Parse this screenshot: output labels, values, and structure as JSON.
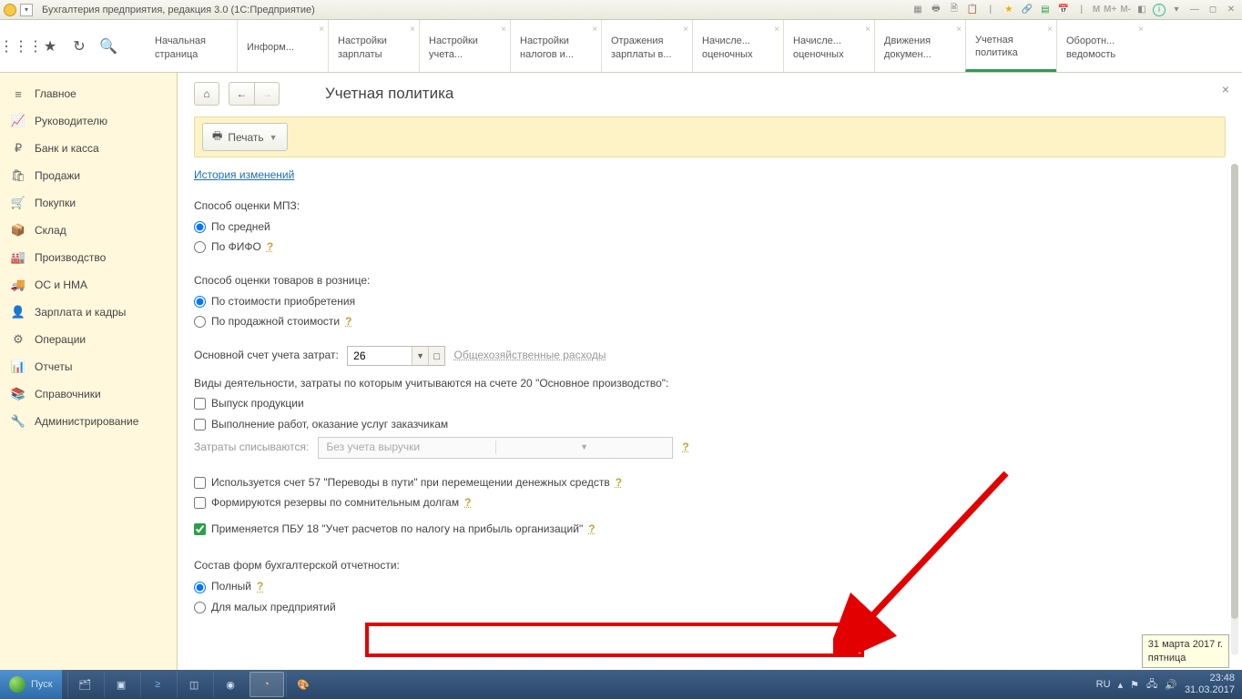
{
  "titlebar": {
    "app_title": "Бухгалтерия предприятия, редакция 3.0  (1С:Предприятие)",
    "m1": "М",
    "m2": "М+",
    "m3": "М-"
  },
  "tabs": [
    {
      "l1": "Начальная",
      "l2": "страница"
    },
    {
      "l1": "Информ...",
      "l2": ""
    },
    {
      "l1": "Настройки",
      "l2": "зарплаты"
    },
    {
      "l1": "Настройки",
      "l2": "учета..."
    },
    {
      "l1": "Настройки",
      "l2": "налогов и..."
    },
    {
      "l1": "Отражения",
      "l2": "зарплаты в..."
    },
    {
      "l1": "Начисле...",
      "l2": "оценочных"
    },
    {
      "l1": "Начисле...",
      "l2": "оценочных"
    },
    {
      "l1": "Движения",
      "l2": "докумен..."
    },
    {
      "l1": "Учетная",
      "l2": "политика"
    },
    {
      "l1": "Оборотн...",
      "l2": "ведомость"
    }
  ],
  "sidebar": [
    {
      "icon": "≡",
      "label": "Главное"
    },
    {
      "icon": "📈",
      "label": "Руководителю"
    },
    {
      "icon": "₽",
      "label": "Банк и касса"
    },
    {
      "icon": "🛍",
      "label": "Продажи"
    },
    {
      "icon": "🛒",
      "label": "Покупки"
    },
    {
      "icon": "📦",
      "label": "Склад"
    },
    {
      "icon": "🏭",
      "label": "Производство"
    },
    {
      "icon": "🚚",
      "label": "ОС и НМА"
    },
    {
      "icon": "👤",
      "label": "Зарплата и кадры"
    },
    {
      "icon": "⚙",
      "label": "Операции"
    },
    {
      "icon": "📊",
      "label": "Отчеты"
    },
    {
      "icon": "📚",
      "label": "Справочники"
    },
    {
      "icon": "🔧",
      "label": "Администрирование"
    }
  ],
  "page": {
    "title": "Учетная политика",
    "print": "Печать",
    "history_link": "История изменений",
    "mpz_label": "Способ оценки МПЗ:",
    "mpz_opt1": "По средней",
    "mpz_opt2": "По ФИФО",
    "retail_label": "Способ оценки товаров в рознице:",
    "retail_opt1": "По стоимости приобретения",
    "retail_opt2": "По продажной стоимости",
    "cost_acct_label": "Основной счет учета затрат:",
    "cost_acct_value": "26",
    "cost_acct_hint": "Общехозяйственные расходы",
    "activities_label": "Виды деятельности, затраты по которым учитываются на счете 20 \"Основное производство\":",
    "act_chk1": "Выпуск продукции",
    "act_chk2": "Выполнение работ, оказание услуг заказчикам",
    "writeoff_label": "Затраты списываются:",
    "writeoff_value": "Без учета выручки",
    "usage57": "Используется счет 57 \"Переводы в пути\" при перемещении денежных средств",
    "reserves": "Формируются резервы по сомнительным долгам",
    "pbu18": "Применяется ПБУ 18 \"Учет расчетов по налогу на прибыль организаций\"",
    "reports_label": "Состав форм бухгалтерской отчетности:",
    "reports_opt1": "Полный",
    "reports_opt2": "Для малых предприятий",
    "help": "?"
  },
  "tooltip": {
    "l1": "31 марта 2017 г.",
    "l2": "пятница"
  },
  "taskbar": {
    "start": "Пуск",
    "lang": "RU",
    "time": "23:48",
    "date": "31.03.2017"
  }
}
